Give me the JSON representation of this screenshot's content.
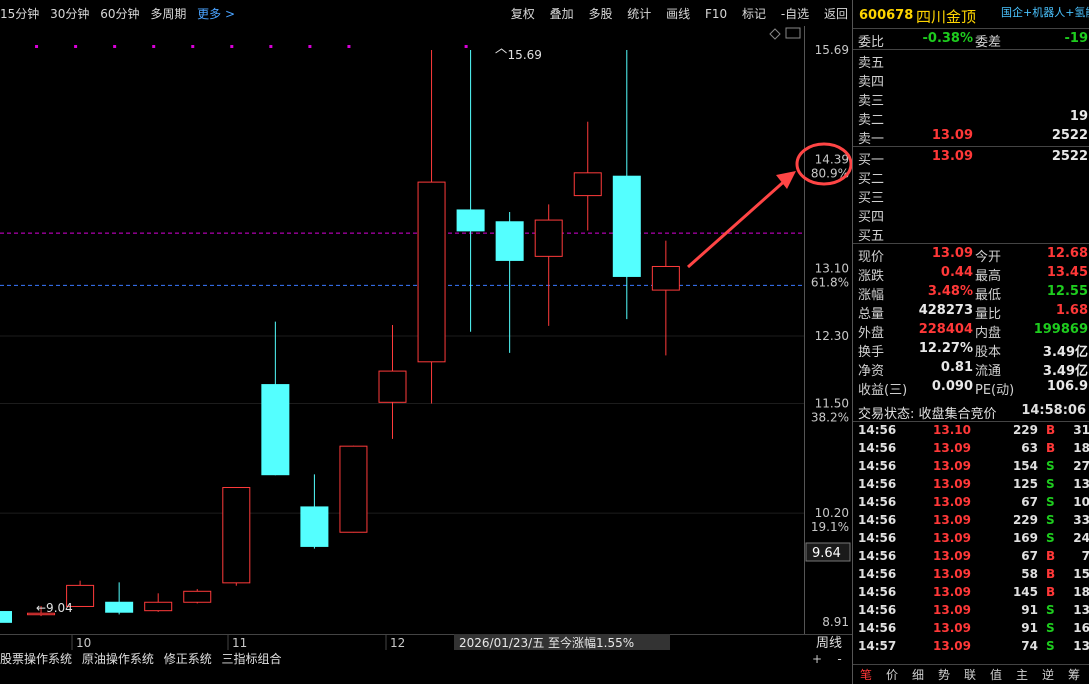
{
  "toolbar": {
    "periods": [
      "15分钟",
      "30分钟",
      "60分钟",
      "多周期"
    ],
    "more_label": "更多 >",
    "actions": [
      "复权",
      "叠加",
      "多股",
      "统计",
      "画线",
      "F10",
      "标记",
      "-自选",
      "返回"
    ]
  },
  "chart_data": {
    "type": "candlestick",
    "price_range": [
      8.91,
      15.69
    ],
    "candles": [
      {
        "open": 9.04,
        "close": 8.9,
        "high": 9.04,
        "low": 8.85,
        "dir": "down"
      },
      {
        "open": 9.02,
        "close": 9.02,
        "high": 9.1,
        "low": 8.98,
        "dir": "up"
      },
      {
        "open": 9.1,
        "close": 9.35,
        "high": 9.4,
        "low": 9.1,
        "dir": "up"
      },
      {
        "open": 9.15,
        "close": 9.02,
        "high": 9.38,
        "low": 9.0,
        "dir": "down"
      },
      {
        "open": 9.05,
        "close": 9.15,
        "high": 9.25,
        "low": 9.03,
        "dir": "up"
      },
      {
        "open": 9.15,
        "close": 9.28,
        "high": 9.3,
        "low": 9.13,
        "dir": "up"
      },
      {
        "open": 9.38,
        "close": 10.51,
        "high": 10.51,
        "low": 9.34,
        "dir": "up"
      },
      {
        "open": 11.73,
        "close": 10.65,
        "high": 12.47,
        "low": 10.65,
        "dir": "down"
      },
      {
        "open": 10.28,
        "close": 9.8,
        "high": 10.66,
        "low": 9.78,
        "dir": "down"
      },
      {
        "open": 9.98,
        "close": 11.0,
        "high": 11.0,
        "low": 9.97,
        "dir": "up"
      },
      {
        "open": 11.52,
        "close": 11.89,
        "high": 12.43,
        "low": 11.08,
        "dir": "up"
      },
      {
        "open": 12.0,
        "close": 14.13,
        "high": 15.69,
        "low": 11.5,
        "dir": "up"
      },
      {
        "open": 13.8,
        "close": 13.54,
        "high": 15.69,
        "low": 12.35,
        "dir": "down"
      },
      {
        "open": 13.66,
        "close": 13.19,
        "high": 13.77,
        "low": 12.1,
        "dir": "down"
      },
      {
        "open": 13.25,
        "close": 13.68,
        "high": 13.86,
        "low": 12.42,
        "dir": "up"
      },
      {
        "open": 13.97,
        "close": 14.24,
        "high": 14.84,
        "low": 13.55,
        "dir": "up"
      },
      {
        "open": 14.2,
        "close": 13.0,
        "high": 15.69,
        "low": 12.5,
        "dir": "down"
      },
      {
        "open": 12.85,
        "close": 13.13,
        "high": 13.43,
        "low": 12.07,
        "dir": "up"
      }
    ],
    "axis_labels": [
      {
        "value": 15.69,
        "pct": ""
      },
      {
        "value": 14.39,
        "pct": "80.9%"
      },
      {
        "value": 13.1,
        "pct": "61.8%"
      },
      {
        "value": 12.3,
        "pct": ""
      },
      {
        "value": 11.5,
        "pct": "38.2%"
      },
      {
        "value": 10.2,
        "pct": "19.1%"
      },
      {
        "value": 8.91,
        "pct": ""
      }
    ],
    "current_price_label": "9.64",
    "high_label": "15.69",
    "low_label": "9.04",
    "date_labels": [
      "10",
      "11",
      "12"
    ],
    "date_info": "2026/01/23/五 至今涨幅1.55%",
    "colors": {
      "up": "#ff3b3b",
      "down": "#54ffff",
      "magenta": "#d800d8",
      "dash": "#3a78ff"
    }
  },
  "bottom_systems": [
    "股票操作系统",
    "原油操作系统",
    "修正系统",
    "三指标组合"
  ],
  "period_label": "周线",
  "panel": {
    "code": "600678",
    "name": "四川金顶",
    "tags": "国企+机器人+氢能",
    "weibi_label": "委比",
    "weibi": "-0.38%",
    "weicha_label": "委差",
    "weicha": "-19",
    "sells": [
      {
        "label": "卖五",
        "price": "",
        "vol": ""
      },
      {
        "label": "卖四",
        "price": "",
        "vol": ""
      },
      {
        "label": "卖三",
        "price": "",
        "vol": ""
      },
      {
        "label": "卖二",
        "price": "",
        "vol": "19"
      },
      {
        "label": "卖一",
        "price": "13.09",
        "vol": "2522"
      }
    ],
    "buys": [
      {
        "label": "买一",
        "price": "13.09",
        "vol": "2522"
      },
      {
        "label": "买二",
        "price": "",
        "vol": ""
      },
      {
        "label": "买三",
        "price": "",
        "vol": ""
      },
      {
        "label": "买四",
        "price": "",
        "vol": ""
      },
      {
        "label": "买五",
        "price": "",
        "vol": ""
      }
    ],
    "stats": [
      {
        "l1": "现价",
        "v1": "13.09",
        "c1": "red",
        "l2": "今开",
        "v2": "12.68",
        "c2": "red"
      },
      {
        "l1": "涨跌",
        "v1": "0.44",
        "c1": "red",
        "l2": "最高",
        "v2": "13.45",
        "c2": "red"
      },
      {
        "l1": "涨幅",
        "v1": "3.48%",
        "c1": "red",
        "l2": "最低",
        "v2": "12.55",
        "c2": "green"
      },
      {
        "l1": "总量",
        "v1": "428273",
        "c1": "white",
        "l2": "量比",
        "v2": "1.68",
        "c2": "red"
      },
      {
        "l1": "外盘",
        "v1": "228404",
        "c1": "red",
        "l2": "内盘",
        "v2": "199869",
        "c2": "green"
      },
      {
        "l1": "换手",
        "v1": "12.27%",
        "c1": "white",
        "l2": "股本",
        "v2": "3.49亿",
        "c2": "white"
      },
      {
        "l1": "净资",
        "v1": "0.81",
        "c1": "white",
        "l2": "流通",
        "v2": "3.49亿",
        "c2": "white"
      },
      {
        "l1": "收益(三)",
        "v1": "0.090",
        "c1": "white",
        "l2": "PE(动)",
        "v2": "106.9",
        "c2": "white"
      }
    ],
    "status_label": "交易状态: 收盘集合竞价",
    "status_time": "14:58:06",
    "trades": [
      {
        "t": "14:56",
        "p": "13.10",
        "q": "229",
        "bs": "B",
        "n": "31"
      },
      {
        "t": "14:56",
        "p": "13.09",
        "q": "63",
        "bs": "B",
        "n": "18"
      },
      {
        "t": "14:56",
        "p": "13.09",
        "q": "154",
        "bs": "S",
        "n": "27"
      },
      {
        "t": "14:56",
        "p": "13.09",
        "q": "125",
        "bs": "S",
        "n": "13"
      },
      {
        "t": "14:56",
        "p": "13.09",
        "q": "67",
        "bs": "S",
        "n": "10"
      },
      {
        "t": "14:56",
        "p": "13.09",
        "q": "229",
        "bs": "S",
        "n": "33"
      },
      {
        "t": "14:56",
        "p": "13.09",
        "q": "169",
        "bs": "S",
        "n": "24"
      },
      {
        "t": "14:56",
        "p": "13.09",
        "q": "67",
        "bs": "B",
        "n": "7"
      },
      {
        "t": "14:56",
        "p": "13.09",
        "q": "58",
        "bs": "B",
        "n": "15"
      },
      {
        "t": "14:56",
        "p": "13.09",
        "q": "145",
        "bs": "B",
        "n": "18"
      },
      {
        "t": "14:56",
        "p": "13.09",
        "q": "91",
        "bs": "S",
        "n": "13"
      },
      {
        "t": "14:56",
        "p": "13.09",
        "q": "91",
        "bs": "S",
        "n": "16"
      },
      {
        "t": "14:57",
        "p": "13.09",
        "q": "74",
        "bs": "S",
        "n": "13"
      }
    ],
    "tabs": [
      "笔",
      "价",
      "细",
      "势",
      "联",
      "值",
      "主",
      "逆",
      "筹"
    ],
    "active_tab": 0
  }
}
